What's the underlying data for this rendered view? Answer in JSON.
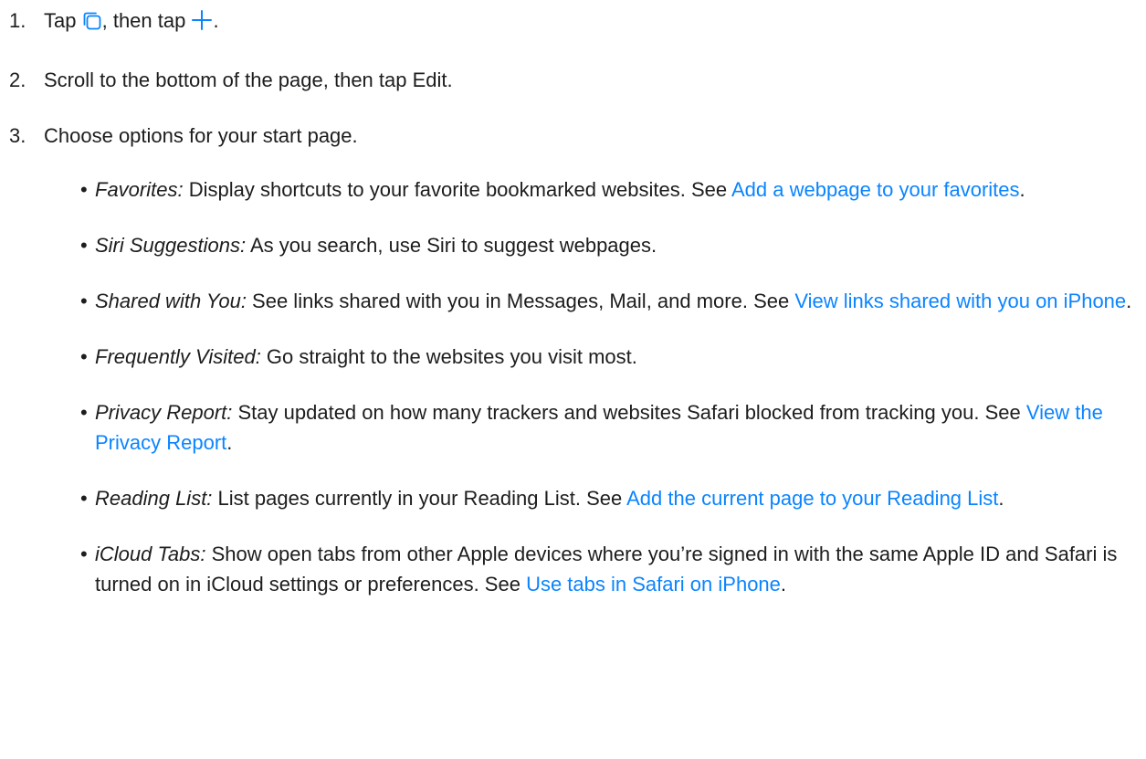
{
  "colors": {
    "text": "#1d1d1f",
    "link": "#0a84ff",
    "background": "#ffffff"
  },
  "steps": [
    {
      "num": "1.",
      "text_a": "Tap",
      "icon_1": "tabs-icon",
      "text_b": ", then tap",
      "icon_2": "plus-icon",
      "text_c": "."
    },
    {
      "num": "2.",
      "text": "Scroll to the bottom of the page, then tap Edit."
    },
    {
      "num": "3.",
      "text": "Choose options for your start page."
    }
  ],
  "options": [
    {
      "term": "Favorites:",
      "desc": " Display shortcuts to your favorite bookmarked websites. See ",
      "link": "Add a webpage to your favorites",
      "tail": "."
    },
    {
      "term": "Siri Suggestions:",
      "desc": " As you search, use Siri to suggest webpages."
    },
    {
      "term": "Shared with You:",
      "desc": " See links shared with you in Messages, Mail, and more. See ",
      "link": "View links shared with you on iPhone",
      "tail": "."
    },
    {
      "term": "Frequently Visited:",
      "desc": " Go straight to the websites you visit most."
    },
    {
      "term": "Privacy Report:",
      "desc": " Stay updated on how many trackers and websites Safari blocked from tracking you. See ",
      "link": "View the Privacy Report",
      "tail": "."
    },
    {
      "term": "Reading List:",
      "desc": " List pages currently in your Reading List. See ",
      "link": "Add the current page to your Reading List",
      "tail": "."
    },
    {
      "term": "iCloud Tabs:",
      "desc": " Show open tabs from other Apple devices where you’re signed in with the same Apple ID and Safari is turned on in iCloud settings or preferences. See ",
      "link": "Use tabs in Safari on iPhone",
      "tail": "."
    }
  ],
  "bullet": "•"
}
